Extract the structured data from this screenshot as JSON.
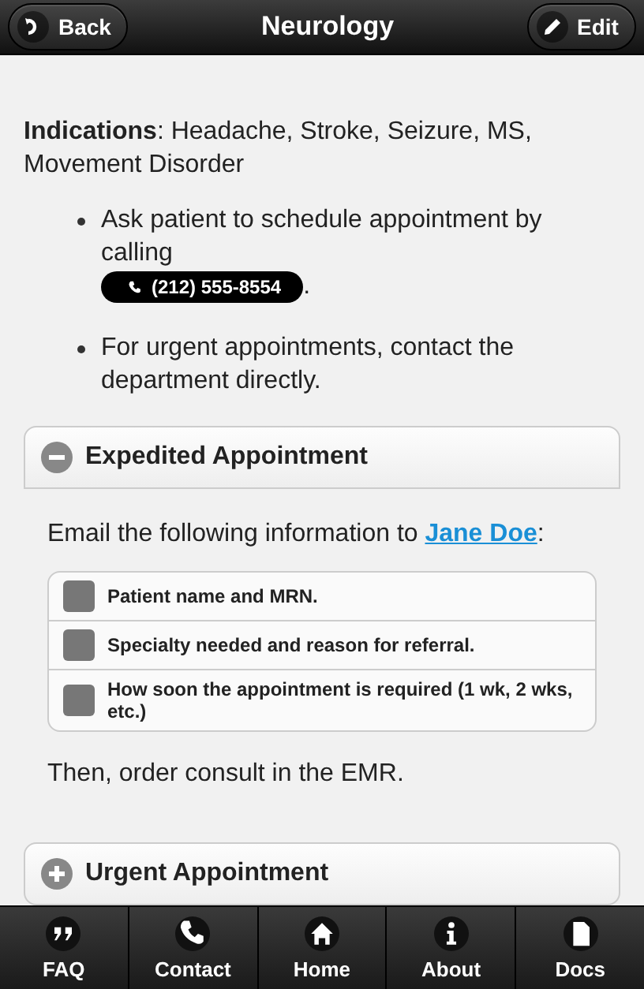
{
  "header": {
    "back": "Back",
    "title": "Neurology",
    "edit": "Edit"
  },
  "indications": "**Indications**: Headache, Stroke, Seizure, MS, Movement Disorder",
  "bullets": [
    {
      "text": "Ask patient to schedule appointment by calling",
      "phone": "(212) 555-8554",
      "after": "."
    },
    {
      "text": "For urgent appointments, contact the department directly."
    }
  ],
  "sections": [
    {
      "title": "Expedited Appointment",
      "expanded": true,
      "intro": "Email the following information to ",
      "link": "Jane Doe",
      "intro_end": ":",
      "items": [
        {
          "label": "Patient name and MRN.",
          "checked": false
        },
        {
          "label": "Specialty needed and reason for referral.",
          "checked": false
        },
        {
          "label": "How soon the appointment is required (1 wk, 2 wks, etc.)",
          "checked": false
        }
      ],
      "outro": "Then, order consult in the EMR."
    },
    {
      "title": "Urgent Appointment",
      "expanded": false
    }
  ],
  "tabs": [
    {
      "kind": "faq",
      "label": "FAQ"
    },
    {
      "kind": "contact",
      "label": "Contact"
    },
    {
      "kind": "home",
      "label": "Home"
    },
    {
      "kind": "about",
      "label": "About"
    },
    {
      "kind": "docs",
      "label": "Docs"
    }
  ]
}
